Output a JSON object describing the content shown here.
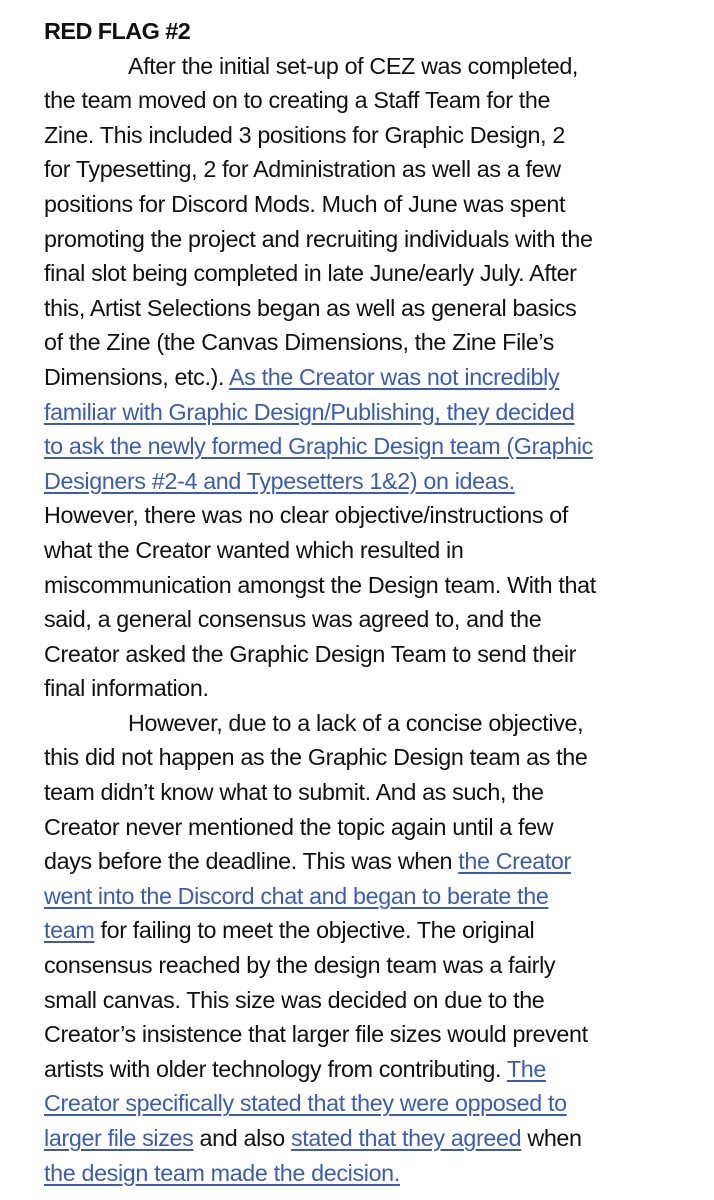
{
  "document": {
    "title": "RED FLAG #2",
    "link_color": "#3a5bb8",
    "lines": [
      {
        "indent": true,
        "segments": [
          {
            "text": "After the initial set-up of CEZ was completed,",
            "link": false
          }
        ]
      },
      {
        "indent": false,
        "segments": [
          {
            "text": "the team moved on to creating a Staff Team for the",
            "link": false
          }
        ]
      },
      {
        "indent": false,
        "segments": [
          {
            "text": "Zine. This included 3 positions for Graphic Design, 2",
            "link": false
          }
        ]
      },
      {
        "indent": false,
        "segments": [
          {
            "text": "for Typesetting, 2 for Administration as well as a few",
            "link": false
          }
        ]
      },
      {
        "indent": false,
        "segments": [
          {
            "text": "positions for Discord Mods. Much of June was spent",
            "link": false
          }
        ]
      },
      {
        "indent": false,
        "segments": [
          {
            "text": "promoting the project and recruiting individuals with the",
            "link": false
          }
        ]
      },
      {
        "indent": false,
        "segments": [
          {
            "text": "final slot being completed in late June/early July. After",
            "link": false
          }
        ]
      },
      {
        "indent": false,
        "segments": [
          {
            "text": "this, Artist Selections began as well as general basics",
            "link": false
          }
        ]
      },
      {
        "indent": false,
        "segments": [
          {
            "text": "of the Zine (the Canvas Dimensions, the Zine File’s",
            "link": false
          }
        ]
      },
      {
        "indent": false,
        "segments": [
          {
            "text": "Dimensions, etc.). ",
            "link": false
          },
          {
            "text": "As the Creator was not incredibly",
            "link": true
          }
        ]
      },
      {
        "indent": false,
        "segments": [
          {
            "text": "familiar with Graphic Design/Publishing, they decided",
            "link": true
          }
        ]
      },
      {
        "indent": false,
        "segments": [
          {
            "text": "to ask the newly formed Graphic Design team (Graphic",
            "link": true
          }
        ]
      },
      {
        "indent": false,
        "segments": [
          {
            "text": "Designers #2-4 and Typesetters 1&2) on ideas.",
            "link": true
          }
        ]
      },
      {
        "indent": false,
        "segments": [
          {
            "text": "However, there was no clear objective/instructions of",
            "link": false
          }
        ]
      },
      {
        "indent": false,
        "segments": [
          {
            "text": "what the Creator wanted which resulted in",
            "link": false
          }
        ]
      },
      {
        "indent": false,
        "segments": [
          {
            "text": "miscommunication amongst the Design team. With that",
            "link": false
          }
        ]
      },
      {
        "indent": false,
        "segments": [
          {
            "text": "said, a general consensus was agreed to, and the",
            "link": false
          }
        ]
      },
      {
        "indent": false,
        "segments": [
          {
            "text": "Creator asked the Graphic Design Team to send their",
            "link": false
          }
        ]
      },
      {
        "indent": false,
        "segments": [
          {
            "text": "final information.",
            "link": false
          }
        ]
      },
      {
        "indent": true,
        "segments": [
          {
            "text": "However, due to a lack of a concise objective,",
            "link": false
          }
        ]
      },
      {
        "indent": false,
        "segments": [
          {
            "text": "this did not happen as the Graphic Design team as the",
            "link": false
          }
        ]
      },
      {
        "indent": false,
        "segments": [
          {
            "text": "team didn’t know what to submit. And as such, the",
            "link": false
          }
        ]
      },
      {
        "indent": false,
        "segments": [
          {
            "text": "Creator never mentioned the topic again until a few",
            "link": false
          }
        ]
      },
      {
        "indent": false,
        "segments": [
          {
            "text": "days before the deadline. This was when ",
            "link": false
          },
          {
            "text": "the Creator",
            "link": true
          }
        ]
      },
      {
        "indent": false,
        "segments": [
          {
            "text": "went into the Discord chat and began to berate the",
            "link": true
          }
        ]
      },
      {
        "indent": false,
        "segments": [
          {
            "text": "team",
            "link": true
          },
          {
            "text": " for failing to meet the objective. The original",
            "link": false
          }
        ]
      },
      {
        "indent": false,
        "segments": [
          {
            "text": "consensus reached by the design team was a fairly",
            "link": false
          }
        ]
      },
      {
        "indent": false,
        "segments": [
          {
            "text": "small canvas. This size was decided on due to the",
            "link": false
          }
        ]
      },
      {
        "indent": false,
        "segments": [
          {
            "text": "Creator’s insistence that larger file sizes would prevent",
            "link": false
          }
        ]
      },
      {
        "indent": false,
        "segments": [
          {
            "text": "artists with older technology from contributing. ",
            "link": false
          },
          {
            "text": "The",
            "link": true
          }
        ]
      },
      {
        "indent": false,
        "segments": [
          {
            "text": "Creator specifically stated that they were opposed to",
            "link": true
          }
        ]
      },
      {
        "indent": false,
        "segments": [
          {
            "text": "larger file sizes",
            "link": true
          },
          {
            "text": " and also ",
            "link": false
          },
          {
            "text": "stated that they agreed",
            "link": true
          },
          {
            "text": " when",
            "link": false
          }
        ]
      },
      {
        "indent": false,
        "segments": [
          {
            "text": "the design team made the decision.",
            "link": true
          }
        ]
      }
    ]
  }
}
